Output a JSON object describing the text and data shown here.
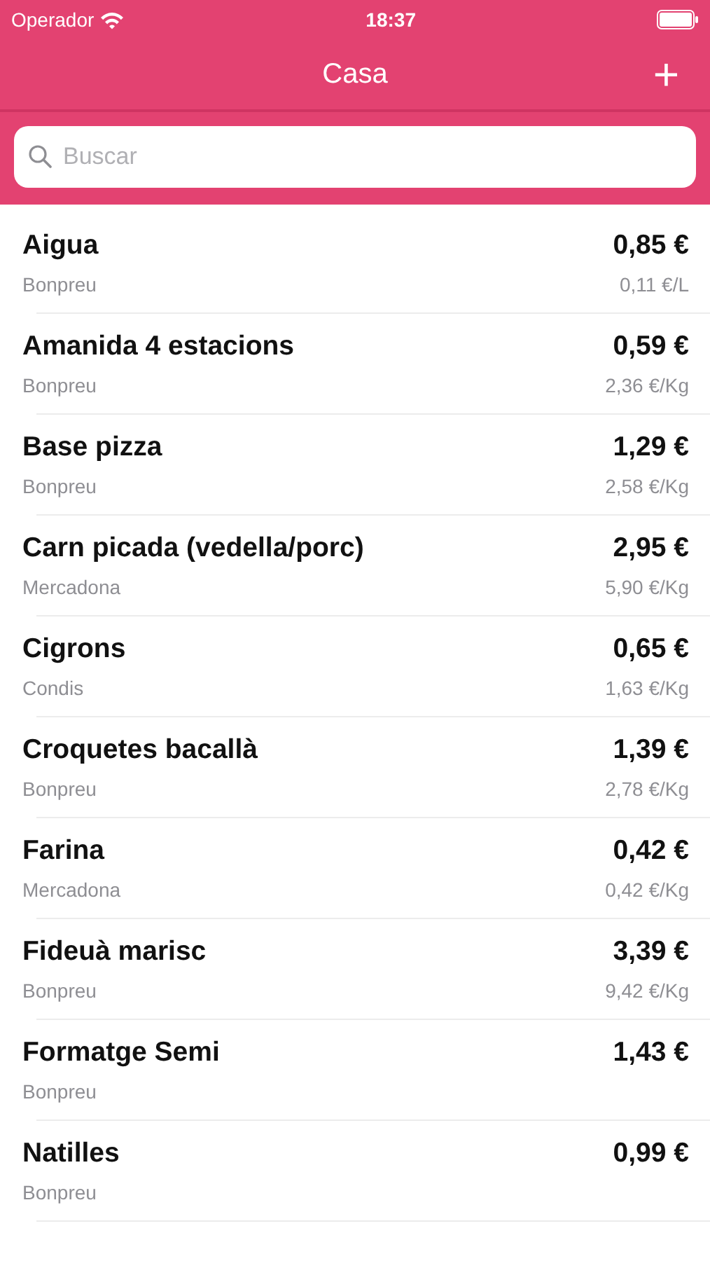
{
  "status_bar": {
    "carrier": "Operador",
    "time": "18:37"
  },
  "nav": {
    "title": "Casa",
    "add": "+"
  },
  "search": {
    "placeholder": "Buscar"
  },
  "items": [
    {
      "name": "Aigua",
      "store": "Bonpreu",
      "price": "0,85 €",
      "unit_price": "0,11 €/L"
    },
    {
      "name": "Amanida 4 estacions",
      "store": "Bonpreu",
      "price": "0,59 €",
      "unit_price": "2,36 €/Kg"
    },
    {
      "name": "Base pizza",
      "store": "Bonpreu",
      "price": "1,29 €",
      "unit_price": "2,58 €/Kg"
    },
    {
      "name": "Carn picada (vedella/porc)",
      "store": "Mercadona",
      "price": "2,95 €",
      "unit_price": "5,90 €/Kg"
    },
    {
      "name": "Cigrons",
      "store": "Condis",
      "price": "0,65 €",
      "unit_price": "1,63 €/Kg"
    },
    {
      "name": "Croquetes bacallà",
      "store": "Bonpreu",
      "price": "1,39 €",
      "unit_price": "2,78 €/Kg"
    },
    {
      "name": "Farina",
      "store": "Mercadona",
      "price": "0,42 €",
      "unit_price": "0,42 €/Kg"
    },
    {
      "name": "Fideuà marisc",
      "store": "Bonpreu",
      "price": "3,39 €",
      "unit_price": "9,42 €/Kg"
    },
    {
      "name": "Formatge Semi",
      "store": "Bonpreu",
      "price": "1,43 €"
    },
    {
      "name": "Natilles",
      "store": "Bonpreu",
      "price": "0,99 €"
    }
  ]
}
